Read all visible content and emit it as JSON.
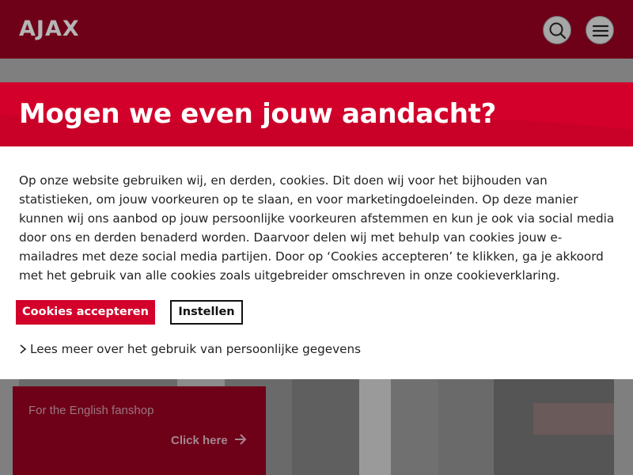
{
  "header": {
    "logo": "AJAX",
    "search_icon": "search-icon",
    "menu_icon": "hamburger-menu-icon"
  },
  "cookie_modal": {
    "title": "Mogen we even jouw aandacht?",
    "body": "Op onze website gebruiken wij, en derden, cookies. Dit doen wij voor het bijhouden van statistieken, om jouw voorkeuren op te slaan, en voor marketingdoeleinden. Op deze manier kunnen wij ons aanbod op jouw persoonlijke voorkeuren afstemmen en kun je ook via social media door ons en derden benaderd worden. Daarvoor delen wij met behulp van cookies jouw e-mailadres met deze social media partijen. Door op ‘Cookies accepteren’ te klikken, ga je akkoord met het gebruik van alle cookies zoals uitgebreider omschreven in onze cookieverklaring.",
    "accept_label": "Cookies accepteren",
    "settings_label": "Instellen",
    "more_link": "Lees meer over het gebruik van persoonlijke gegevens",
    "more_icon": "chevron-right-icon"
  },
  "promo": {
    "text": "For the English fanshop",
    "link": "Click here",
    "link_icon": "arrow-right-icon"
  },
  "colors": {
    "brand_red": "#d2002a",
    "header_dimmed": "#6e0018",
    "overlay": "#7f7f7f"
  }
}
